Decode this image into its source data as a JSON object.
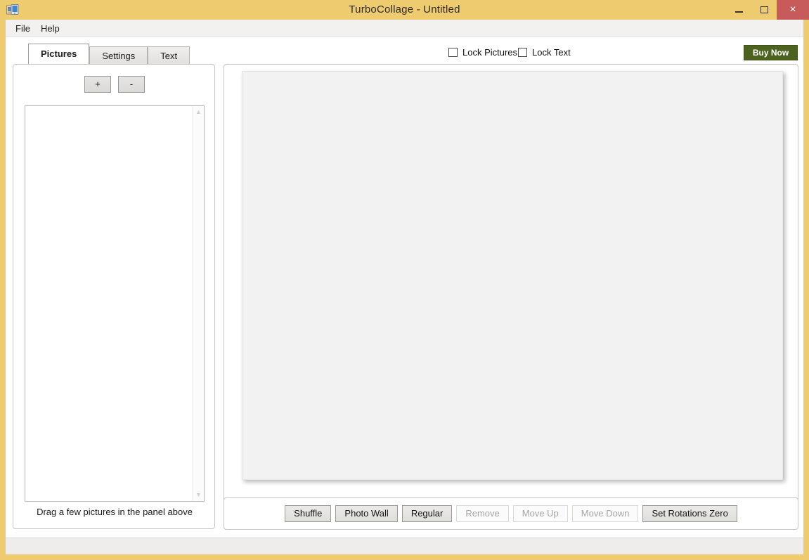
{
  "window": {
    "title": "TurboCollage - Untitled",
    "icon": "app-photos-icon",
    "titlebar_color": "#eecb6e",
    "controls": {
      "minimize": "–",
      "maximize": "□",
      "close": "×",
      "close_color": "#c75b5b"
    }
  },
  "menu": {
    "items": [
      {
        "label": "File"
      },
      {
        "label": "Help"
      }
    ]
  },
  "tabs": [
    {
      "label": "Pictures",
      "active": true
    },
    {
      "label": "Settings",
      "active": false
    },
    {
      "label": "Text",
      "active": false
    }
  ],
  "top_strip": {
    "lock_pictures": {
      "label": "Lock Pictures",
      "checked": false
    },
    "lock_text": {
      "label": "Lock Text",
      "checked": false
    },
    "buy_now": {
      "label": "Buy Now",
      "color": "#4e6220"
    }
  },
  "left_panel": {
    "add_button": "+",
    "remove_button": "-",
    "list_items": [],
    "scrollbar": {
      "up_arrow": "▲",
      "down_arrow": "▼"
    },
    "hint": "Drag a few pictures in the panel above"
  },
  "canvas": {
    "background": "#f2f2f2"
  },
  "toolbar": {
    "buttons": [
      {
        "label": "Shuffle",
        "enabled": true
      },
      {
        "label": "Photo Wall",
        "enabled": true
      },
      {
        "label": "Regular",
        "enabled": true
      },
      {
        "label": "Remove",
        "enabled": false
      },
      {
        "label": "Move Up",
        "enabled": false
      },
      {
        "label": "Move Down",
        "enabled": false
      },
      {
        "label": "Set Rotations Zero",
        "enabled": true
      }
    ]
  },
  "statusbar": {
    "text": ""
  }
}
